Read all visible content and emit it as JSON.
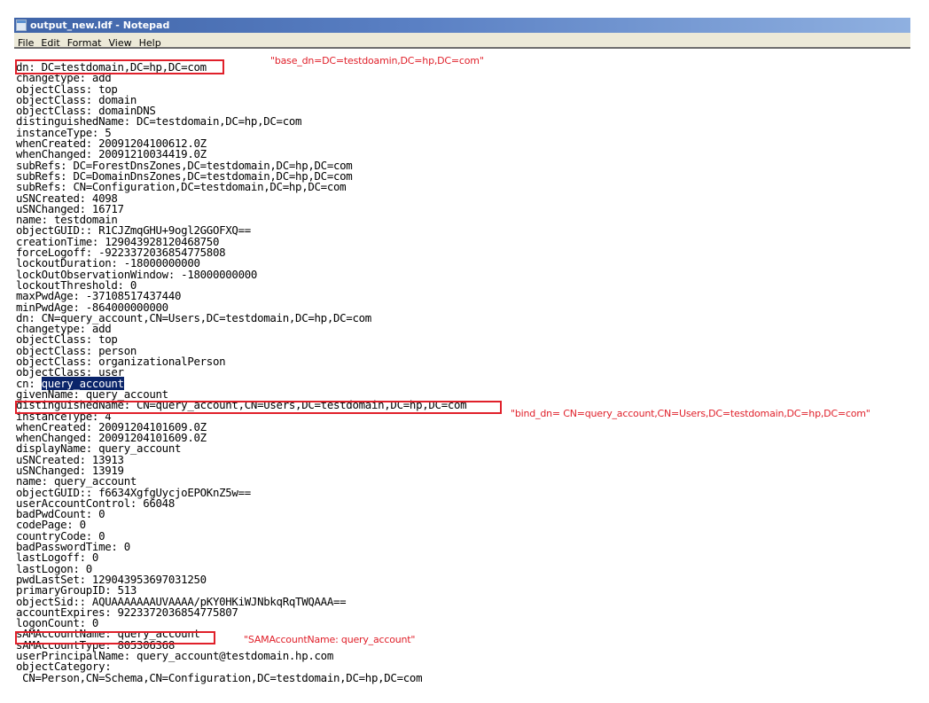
{
  "window": {
    "title": "output_new.ldf - Notepad",
    "app_icon": "notepad-icon"
  },
  "menu": [
    "File",
    "Edit",
    "Format",
    "View",
    "Help"
  ],
  "document": {
    "selected_text": "query_account",
    "lines": [
      "dn: DC=testdomain,DC=hp,DC=com",
      "changetype: add",
      "objectClass: top",
      "objectClass: domain",
      "objectClass: domainDNS",
      "distinguishedName: DC=testdomain,DC=hp,DC=com",
      "instanceType: 5",
      "whenCreated: 20091204100612.0Z",
      "whenChanged: 20091210034419.0Z",
      "subRefs: DC=ForestDnsZones,DC=testdomain,DC=hp,DC=com",
      "subRefs: DC=DomainDnsZones,DC=testdomain,DC=hp,DC=com",
      "subRefs: CN=Configuration,DC=testdomain,DC=hp,DC=com",
      "uSNCreated: 4098",
      "uSNChanged: 16717",
      "name: testdomain",
      "objectGUID:: R1CJZmqGHU+9ogl2GGOFXQ==",
      "creationTime: 129043928120468750",
      "forceLogoff: -9223372036854775808",
      "lockoutDuration: -18000000000",
      "lockOutObservationWindow: -18000000000",
      "lockoutThreshold: 0",
      "maxPwdAge: -37108517437440",
      "minPwdAge: -864000000000",
      "dn: CN=query_account,CN=Users,DC=testdomain,DC=hp,DC=com",
      "changetype: add",
      "objectClass: top",
      "objectClass: person",
      "objectClass: organizationalPerson",
      "objectClass: user",
      "cn: ",
      "givenName: query_account",
      "distinguishedName: CN=query_account,CN=Users,DC=testdomain,DC=hp,DC=com",
      "instanceType: 4",
      "whenCreated: 20091204101609.0Z",
      "whenChanged: 20091204101609.0Z",
      "displayName: query_account",
      "uSNCreated: 13913",
      "uSNChanged: 13919",
      "name: query_account",
      "objectGUID:: f6634XgfgUycjoEPOKnZ5w==",
      "userAccountControl: 66048",
      "badPwdCount: 0",
      "codePage: 0",
      "countryCode: 0",
      "badPasswordTime: 0",
      "lastLogoff: 0",
      "lastLogon: 0",
      "pwdLastSet: 129043953697031250",
      "primaryGroupID: 513",
      "objectSid:: AQUAAAAAAAUVAAAA/pKY0HKiWJNbkqRqTWQAAA==",
      "accountExpires: 9223372036854775807",
      "logonCount: 0",
      "sAMAccountName: query_account",
      "sAMAccountType: 805306368",
      "userPrincipalName: query_account@testdomain.hp.com",
      "objectCategory:",
      " CN=Person,CN=Schema,CN=Configuration,DC=testdomain,DC=hp,DC=com"
    ]
  },
  "annotations": {
    "base_dn": "\"base_dn=DC=testdoamin,DC=hp,DC=com\"",
    "bind_dn": "\"bind_dn= CN=query_account,CN=Users,DC=testdomain,DC=hp,DC=com\"",
    "sam": "\"SAMAccountName: query_account\"",
    "color": "#e0202a"
  },
  "colors": {
    "titlebar_start": "#3f64a8",
    "titlebar_end": "#8fb0e0",
    "menubar": "#ece9d8",
    "selection": "#0a246a"
  }
}
